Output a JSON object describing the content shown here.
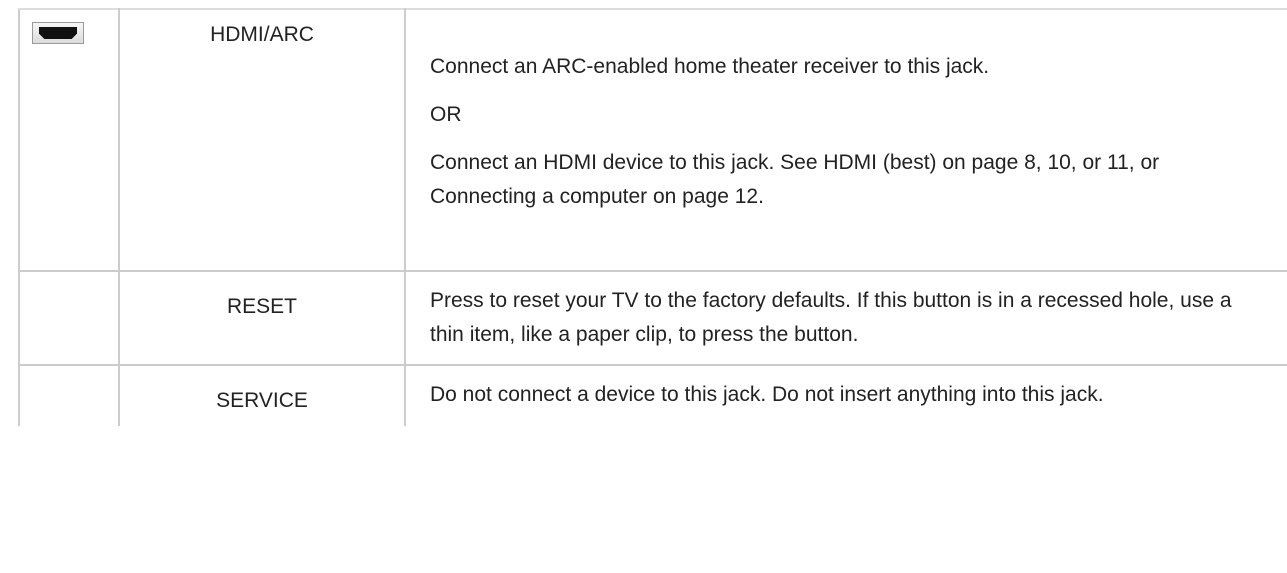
{
  "rows": [
    {
      "icon": "hdmi-port-icon",
      "name": "HDMI/ARC",
      "paragraphs": [
        "Connect an ARC-enabled home theater receiver to this jack.",
        "OR",
        "Connect an HDMI device to this jack. See HDMI (best) on page 8, 10, or 11, or Connecting a computer on page 12."
      ]
    },
    {
      "icon": "",
      "name": "RESET",
      "paragraphs": [
        "Press to reset your TV to the factory defaults. If this button is in a recessed hole, use a thin item, like a paper clip, to press the button."
      ]
    },
    {
      "icon": "",
      "name": "SERVICE",
      "paragraphs": [
        "Do not connect a device to this jack. Do not insert anything into this jack."
      ]
    }
  ]
}
